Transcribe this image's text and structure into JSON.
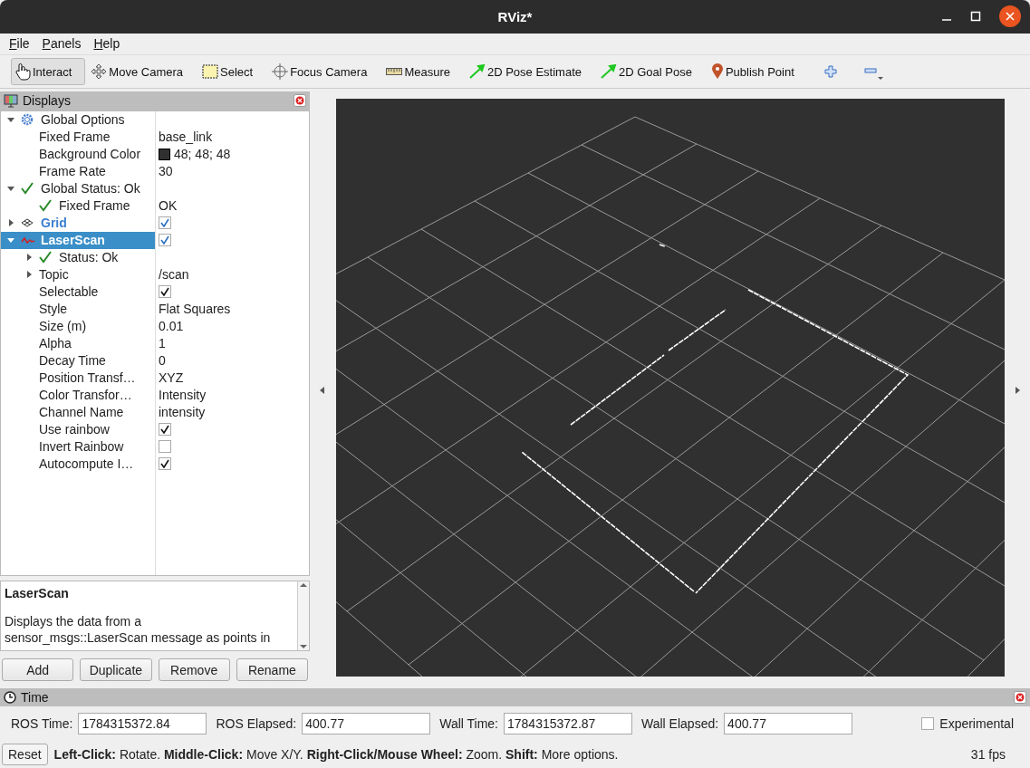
{
  "window": {
    "title": "RViz*"
  },
  "menu": [
    {
      "label": "File"
    },
    {
      "label": "Panels"
    },
    {
      "label": "Help"
    }
  ],
  "toolbar": {
    "tools": [
      {
        "label": "Interact",
        "kind": "hand",
        "selected": true
      },
      {
        "label": "Move Camera",
        "kind": "move",
        "selected": false
      },
      {
        "label": "Select",
        "kind": "select",
        "selected": false
      },
      {
        "label": "Focus Camera",
        "kind": "focus",
        "selected": false
      },
      {
        "label": "Measure",
        "kind": "ruler",
        "selected": false
      },
      {
        "label": "2D Pose Estimate",
        "kind": "arrow",
        "selected": false
      },
      {
        "label": "2D Goal Pose",
        "kind": "arrow",
        "selected": false
      },
      {
        "label": "Publish Point",
        "kind": "pin",
        "selected": false
      }
    ],
    "actions": [
      {
        "kind": "add"
      },
      {
        "kind": "remove"
      }
    ]
  },
  "displays": {
    "title": "Displays",
    "items": [
      {
        "label": "Global Options",
        "kind": "gear",
        "expanded": true,
        "children": [
          {
            "label": "Fixed Frame",
            "value": "base_link"
          },
          {
            "label": "Background Color",
            "value": "48; 48; 48",
            "color": "#303030"
          },
          {
            "label": "Frame Rate",
            "value": "30"
          }
        ]
      },
      {
        "label": "Global Status: Ok",
        "kind": "check",
        "expanded": true,
        "children": [
          {
            "label": "Fixed Frame",
            "kind": "check",
            "value": "OK"
          }
        ]
      },
      {
        "label": "Grid",
        "kind": "grid",
        "expanded": false,
        "checked": true,
        "selected": false
      },
      {
        "label": "LaserScan",
        "kind": "laser",
        "expanded": true,
        "checked": true,
        "selected": true,
        "children": [
          {
            "label": "Status: Ok",
            "kind": "check",
            "expanded": false
          },
          {
            "label": "Topic",
            "value": "/scan",
            "expanded": false
          },
          {
            "label": "Selectable",
            "checked": true
          },
          {
            "label": "Style",
            "value": "Flat Squares"
          },
          {
            "label": "Size (m)",
            "value": "0.01"
          },
          {
            "label": "Alpha",
            "value": "1"
          },
          {
            "label": "Decay Time",
            "value": "0"
          },
          {
            "label": "Position Transf…",
            "value": "XYZ"
          },
          {
            "label": "Color Transfor…",
            "value": "Intensity"
          },
          {
            "label": "Channel Name",
            "value": "intensity"
          },
          {
            "label": "Use rainbow",
            "checked": true
          },
          {
            "label": "Invert Rainbow",
            "checked": false
          },
          {
            "label": "Autocompute I…",
            "checked": true
          }
        ]
      }
    ],
    "description": {
      "title": "LaserScan",
      "text": "Displays the data from a sensor_msgs::LaserScan message as points in"
    },
    "buttons": [
      "Add",
      "Duplicate",
      "Remove",
      "Rename"
    ]
  },
  "time": {
    "title": "Time",
    "fields": [
      {
        "label": "ROS Time:",
        "value": "1784315372.84"
      },
      {
        "label": "ROS Elapsed:",
        "value": "400.77"
      },
      {
        "label": "Wall Time:",
        "value": "1784315372.87"
      },
      {
        "label": "Wall Elapsed:",
        "value": "400.77"
      }
    ],
    "experimental": {
      "label": "Experimental",
      "checked": false
    }
  },
  "status_bar": {
    "button": "Reset",
    "help": "**Left-Click:** Rotate. **Middle-Click:** Move X/Y. **Right-Click/Mouse Wheel:** Zoom. **Shift:** More options.",
    "fps": "31 fps"
  }
}
